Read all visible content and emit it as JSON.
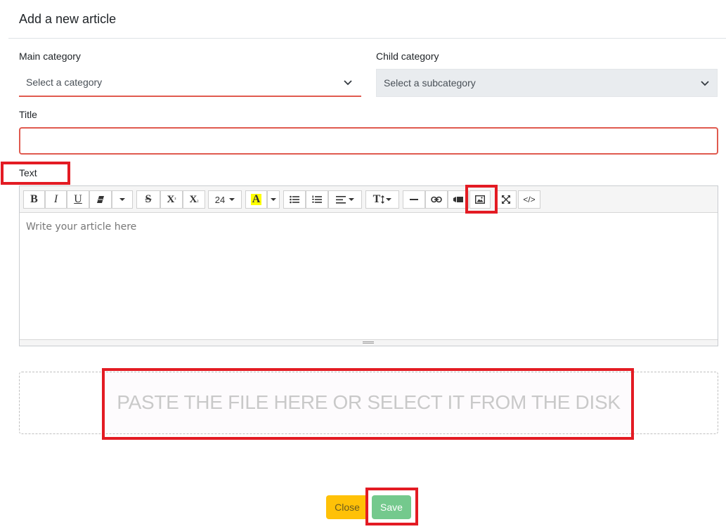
{
  "modal": {
    "title": "Add a new article"
  },
  "form": {
    "main_category": {
      "label": "Main category",
      "value": "Select a category"
    },
    "child_category": {
      "label": "Child category",
      "value": "Select a subcategory"
    },
    "title": {
      "label": "Title",
      "value": ""
    },
    "text": {
      "label": "Text",
      "placeholder": "Write your article here"
    }
  },
  "toolbar": {
    "bold": "B",
    "italic": "I",
    "underline": "U",
    "strikethrough": "S",
    "superscript": "X",
    "superscript_mark": "²",
    "subscript": "X",
    "subscript_mark": "₂",
    "font_size": "24",
    "highlight": "A",
    "line_height": "T",
    "codeview": "</>",
    "icons": [
      "eraser-icon",
      "dropdown-caret-icon",
      "unordered-list-icon",
      "ordered-list-icon",
      "align-icon",
      "horizontal-rule-icon",
      "link-icon",
      "video-icon",
      "image-icon",
      "fullscreen-icon",
      "code-view-icon"
    ],
    "highlight_color": "#ffff00"
  },
  "dropzone": {
    "text": "PASTE THE FILE HERE OR SELECT IT FROM THE DISK"
  },
  "buttons": {
    "close": "Close",
    "save": "Save"
  },
  "colors": {
    "accent_red": "#e31b23",
    "invalid_border": "#e05a4f",
    "close_btn": "#ffc107",
    "save_btn": "#74c98d"
  }
}
